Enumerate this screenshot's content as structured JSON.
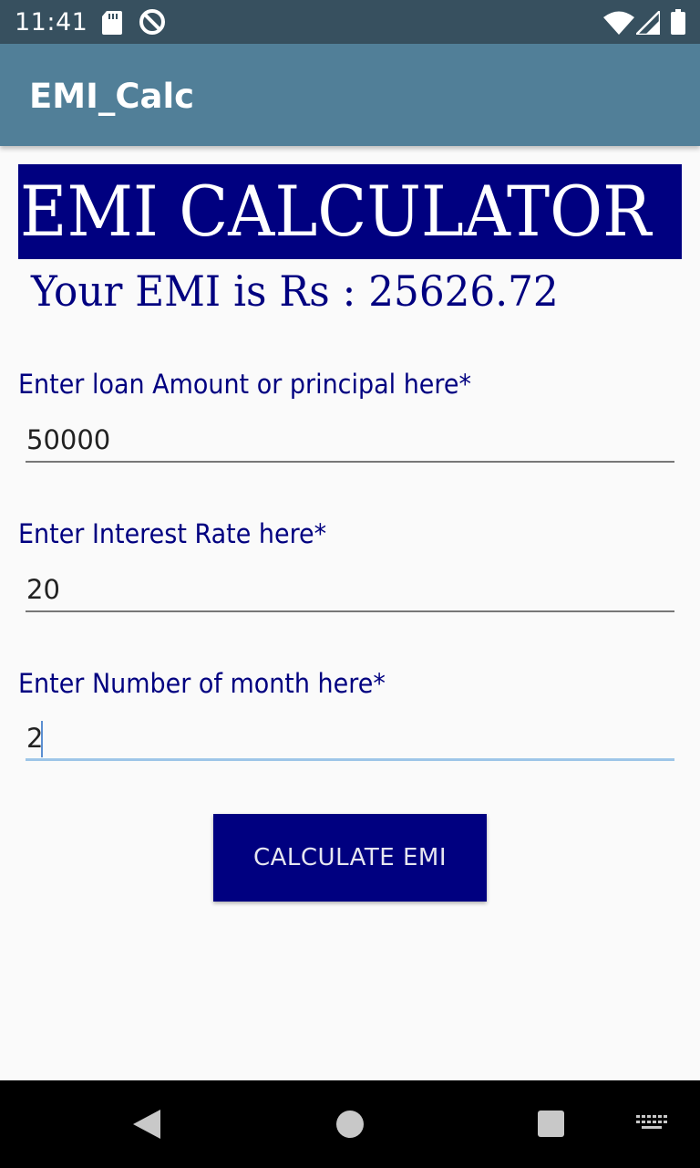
{
  "status_bar": {
    "time": "11:41",
    "icons": [
      "sd-card-icon",
      "no-disturb-icon",
      "wifi-icon",
      "signal-icon",
      "battery-icon"
    ]
  },
  "app_bar": {
    "title": "EMI_Calc"
  },
  "banner": {
    "title": "EMI CALCULATOR"
  },
  "result": {
    "text": "Your EMI is Rs : 25626.72"
  },
  "fields": {
    "principal": {
      "label": "Enter loan Amount or principal here*",
      "value": "50000"
    },
    "rate": {
      "label": "Enter Interest Rate here*",
      "value": "20"
    },
    "months": {
      "label": "Enter Number of month here*",
      "value": "2"
    }
  },
  "button": {
    "label": "CALCULATE EMI"
  },
  "nav_bar": {
    "icons": [
      "back-icon",
      "home-icon",
      "recents-icon",
      "keyboard-icon"
    ]
  },
  "colors": {
    "status_bar": "#37505f",
    "app_bar": "#517f98",
    "accent_navy": "#000080",
    "background": "#fafafa"
  }
}
